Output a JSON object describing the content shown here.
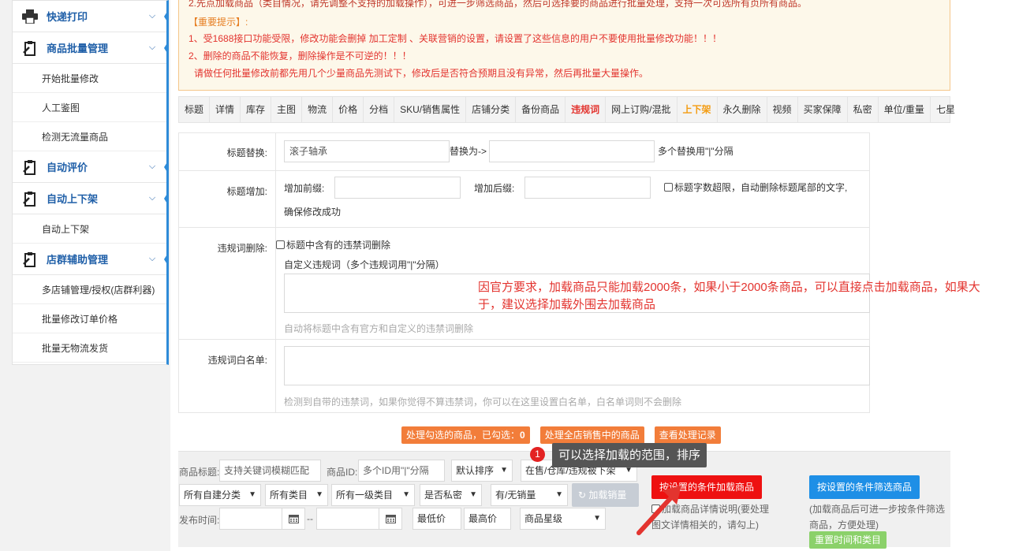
{
  "sidebar": {
    "groups": [
      {
        "label": "快递打印",
        "icon": "printer-icon",
        "items": []
      },
      {
        "label": "商品批量管理",
        "icon": "clipboard-icon",
        "items": [
          "开始批量修改",
          "人工鉴图",
          "检测无流量商品"
        ]
      },
      {
        "label": "自动评价",
        "icon": "clipboard-icon",
        "items": []
      },
      {
        "label": "自动上下架",
        "icon": "clipboard-icon",
        "items": [
          "自动上下架"
        ]
      },
      {
        "label": "店群辅助管理",
        "icon": "clipboard-icon",
        "items": [
          "多店铺管理/授权(店群利器)",
          "批量修改订单价格",
          "批量无物流发货"
        ]
      }
    ]
  },
  "notice": {
    "line0": "2.先点加载商品（类目情况，请先调整不支持的加载操作），可进一步筛选商品，然后可选择要的商品进行批量处理，支持一次可选所有页所有商品。",
    "header": "【重要提示】:",
    "lines": [
      "1、受1688接口功能受限，修改功能会删掉 加工定制 、关联营销的设置，请设置了这些信息的用户不要使用批量修改功能！！！",
      "2、删除的商品不能恢复，删除操作是不可逆的！！！",
      "请做任何批量修改前都先用几个少量商品先测试下，修改后是否符合预期且没有异常，然后再批量大量操作。"
    ]
  },
  "tabs": [
    "标题",
    "详情",
    "库存",
    "主图",
    "物流",
    "价格",
    "分档",
    "SKU/销售属性",
    "店铺分类",
    "备份商品",
    "违规词",
    "网上订购/混批",
    "上下架",
    "永久删除",
    "视频",
    "买家保障",
    "私密",
    "单位/重量",
    "七星"
  ],
  "tabs_active": "违规词",
  "tabs_highlight": "上下架",
  "form": {
    "title_replace": {
      "label": "标题替换:",
      "value": "滚子轴承",
      "replace_to": "替换为->",
      "tip": "多个替换用\"|\"分隔"
    },
    "title_add": {
      "label": "标题增加:",
      "prefix": "增加前缀:",
      "suffix": "增加后缀:",
      "cb_label": "标题字数超限，自动删除标题尾部的文字,",
      "cb_label2": "确保修改成功"
    },
    "violation_delete": {
      "label": "违规词删除:",
      "cb_label": "标题中含有的违禁词删除",
      "custom_label": "自定义违规词（多个违规词用\"|\"分隔）",
      "hint": "自动将标题中含有官方和自定义的违禁词删除"
    },
    "whitelist": {
      "label": "违规词白名单:",
      "hint": "检测到自带的违禁词，如果你觉得不算违禁词，你可以在这里设置白名单，白名单词则不会删除"
    }
  },
  "annotation_red": "因官方要求，加载商品只能加载2000条，如果小于2000条商品，可以直接点击加载商品，如果大于，建议选择加载外围去加载商品",
  "actions": {
    "process_selected": "处理勾选的商品，已勾选：",
    "selected_count": "0",
    "process_all": "处理全店销售中的商品",
    "view_records": "查看处理记录"
  },
  "filter": {
    "title_label": "商品标题:",
    "title_placeholder": "支持关键词模糊匹配",
    "id_label": "商品ID:",
    "id_placeholder": "多个ID用\"|\"分隔",
    "sort": "默认排序",
    "status": "在售/仓库/违规被下架",
    "category1": "所有自建分类",
    "category2": "所有类目",
    "category3": "所有一级类目",
    "private": "是否私密",
    "sales": "有/无销量",
    "load_sales": "加载销量",
    "publish_label": "发布时间:",
    "dash": "--",
    "min_price": "最低价",
    "max_price": "最高价",
    "star": "商品星级",
    "load_button": "按设置的条件加载商品",
    "load_detail_cb": "加载商品详情说明(要处理图文详情相关的，请勾上)",
    "filter_button": "按设置的条件筛选商品",
    "filter_hint": "(加载商品后可进一步按条件筛选商品，方便处理)",
    "reset_button": "重置时间和类目"
  },
  "tooltip": {
    "badge": "1",
    "text": "可以选择加载的范围，排序"
  },
  "colors": {
    "accent": "#2e8bd8",
    "red": "#e3342f",
    "orange": "#f27d3a",
    "blue": "#1e8fe6",
    "green": "#8bd16a"
  }
}
